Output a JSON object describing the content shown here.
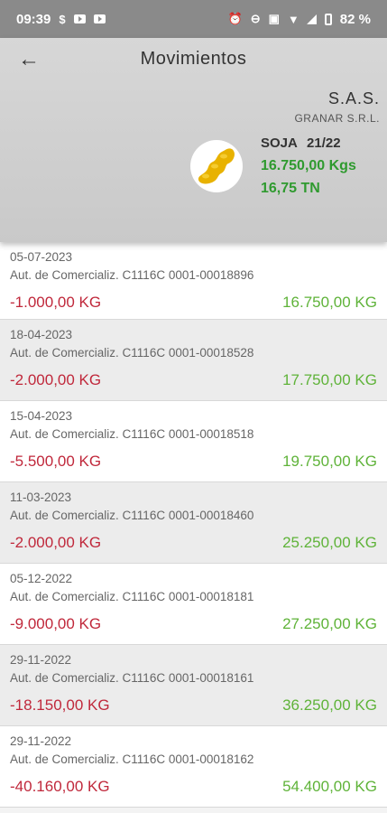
{
  "status": {
    "time": "09:39",
    "battery": "82 %"
  },
  "header": {
    "title": "Movimientos",
    "company": "S.A.S.",
    "company_sub": "GRANAR S.R.L.",
    "crop": "SOJA",
    "campaign": "21/22",
    "kgs": "16.750,00  Kgs",
    "tn": "16,75  TN"
  },
  "colors": {
    "negative": "#c0283b",
    "positive": "#5fb339"
  },
  "movements": [
    {
      "date": "05-07-2023",
      "desc": "Aut. de Comercializ. C1116C 0001-00018896",
      "qty": "-1.000,00 KG",
      "balance": "16.750,00 KG"
    },
    {
      "date": "18-04-2023",
      "desc": "Aut. de Comercializ. C1116C 0001-00018528",
      "qty": "-2.000,00 KG",
      "balance": "17.750,00 KG"
    },
    {
      "date": "15-04-2023",
      "desc": "Aut. de Comercializ. C1116C 0001-00018518",
      "qty": "-5.500,00 KG",
      "balance": "19.750,00 KG"
    },
    {
      "date": "11-03-2023",
      "desc": "Aut. de Comercializ. C1116C 0001-00018460",
      "qty": "-2.000,00 KG",
      "balance": "25.250,00 KG"
    },
    {
      "date": "05-12-2022",
      "desc": "Aut. de Comercializ. C1116C 0001-00018181",
      "qty": "-9.000,00 KG",
      "balance": "27.250,00 KG"
    },
    {
      "date": "29-11-2022",
      "desc": "Aut. de Comercializ. C1116C 0001-00018161",
      "qty": "-18.150,00 KG",
      "balance": "36.250,00 KG"
    },
    {
      "date": "29-11-2022",
      "desc": "Aut. de Comercializ. C1116C 0001-00018162",
      "qty": "-40.160,00 KG",
      "balance": "54.400,00 KG"
    }
  ]
}
